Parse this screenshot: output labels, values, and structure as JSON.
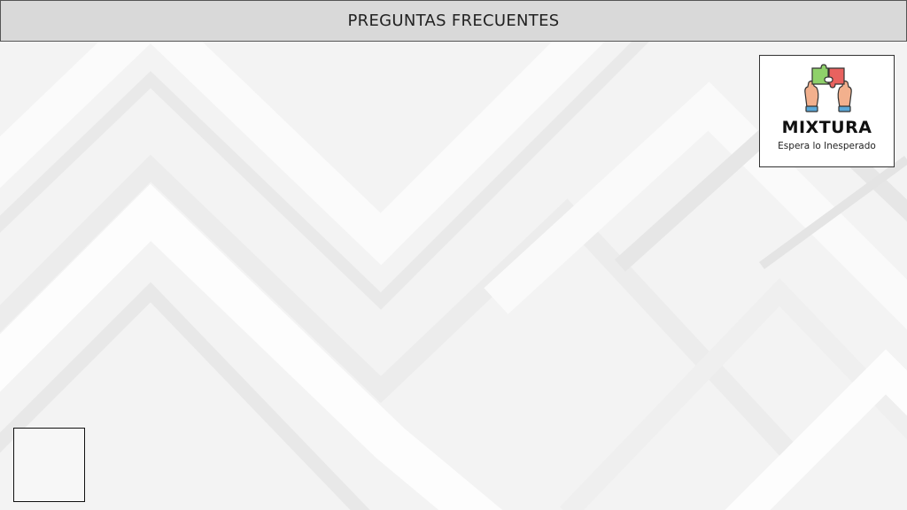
{
  "header": {
    "title": "PREGUNTAS FRECUENTES"
  },
  "logo": {
    "name": "MIXTURA",
    "tagline": "Espera lo Inesperado",
    "icon": "hands-puzzle-icon",
    "colors": {
      "green_piece": "#8fd16a",
      "red_piece": "#e8625f",
      "skin": "#f2b08d",
      "cuff": "#5ba8d8"
    }
  },
  "background": {
    "pattern": "light-gray-chevron-pattern",
    "color": "#f4f4f4"
  },
  "header_bg_color": "#d9d9d9"
}
